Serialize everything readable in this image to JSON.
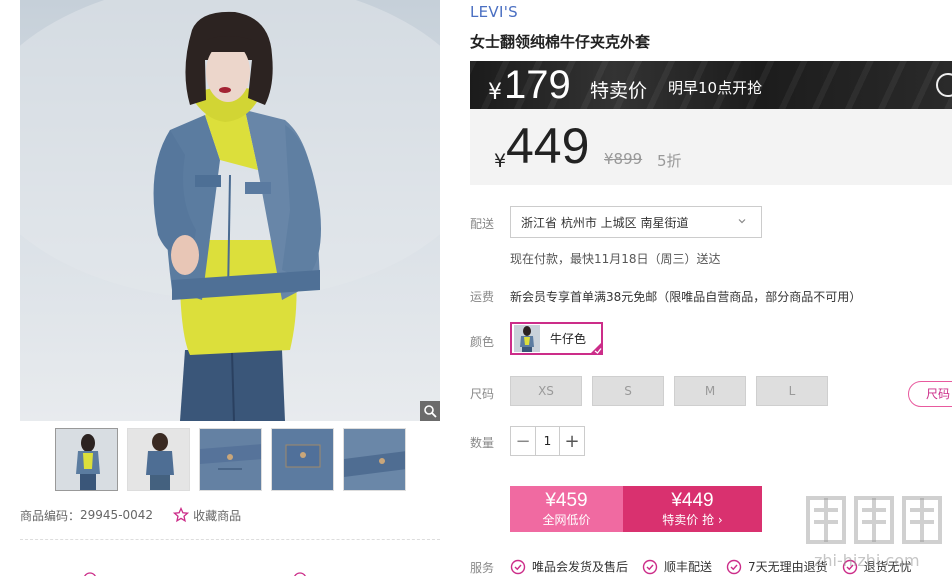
{
  "gallery": {
    "zoom_icon": "magnifier-icon",
    "product_code_label": "商品编码：",
    "product_code": "29945-0042",
    "favorite_label": "收藏商品",
    "favorite_icon": "star-icon"
  },
  "product": {
    "brand": "LEVI'S",
    "title": "女士翻领纯棉牛仔夹克外套"
  },
  "flash_sale": {
    "currency": "¥",
    "price": "179",
    "tag": "特卖价",
    "note": "明早10点开抢"
  },
  "price": {
    "currency": "¥",
    "current": "449",
    "original": "¥899",
    "discount": "5折"
  },
  "delivery": {
    "label": "配送",
    "address": "浙江省 杭州市 上城区 南星街道",
    "note": "现在付款，最快11月18日（周三）送达"
  },
  "shipping": {
    "label": "运费",
    "text": "新会员专享首单满38元免邮（限唯品自营商品，部分商品不可用）"
  },
  "color": {
    "label": "颜色",
    "selected": "牛仔色"
  },
  "size": {
    "label": "尺码",
    "options": [
      "XS",
      "S",
      "M",
      "L"
    ],
    "chart_label": "尺码"
  },
  "quantity": {
    "label": "数量",
    "value": "1",
    "minus": "−",
    "plus": "+"
  },
  "buy": {
    "left_price": "¥459",
    "left_label": "全网低价",
    "right_price": "¥449",
    "right_label": "特卖价 抢 ›"
  },
  "services": {
    "label": "服务",
    "items": [
      "唯品会发货及售后",
      "顺丰配送",
      "7天无理由退货",
      "退货无忧"
    ]
  },
  "colors": {
    "brand_link": "#4a6fc2",
    "accent_pink": "#d9316f",
    "light_pink": "#f06aa1",
    "selected_border": "#cc2d89"
  },
  "watermark": {
    "text": "zhi-hizhi.com"
  }
}
